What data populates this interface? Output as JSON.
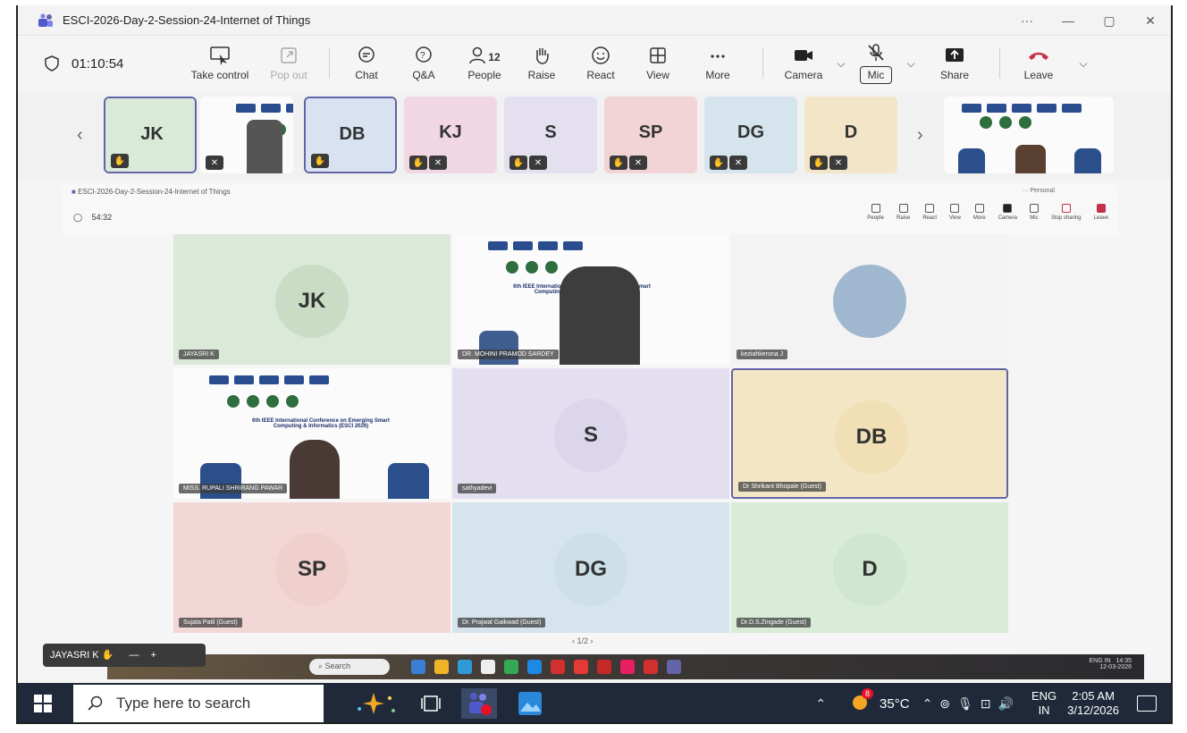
{
  "window": {
    "title": "ESCI-2026-Day-2-Session-24-Internet of Things",
    "more": "···",
    "minimize": "—",
    "maximize": "▢",
    "close": "✕"
  },
  "toolbar": {
    "timer": "01:10:54",
    "take_control": "Take control",
    "pop_out": "Pop out",
    "chat": "Chat",
    "qa": "Q&A",
    "people": "People",
    "people_count": "12",
    "raise": "Raise",
    "react": "React",
    "view": "View",
    "more": "More",
    "camera": "Camera",
    "mic": "Mic",
    "share": "Share",
    "leave": "Leave"
  },
  "strip": {
    "thumbs": [
      {
        "initials": "JK",
        "color": "#d9ead8"
      },
      {
        "initials": "DB",
        "color": "#d8e2f0"
      },
      {
        "initials": "KJ",
        "color": "#f1d6e4"
      },
      {
        "initials": "S",
        "color": "#e4e0f0"
      },
      {
        "initials": "SP",
        "color": "#f3d4d6"
      },
      {
        "initials": "DG",
        "color": "#d6e4ee"
      },
      {
        "initials": "D",
        "color": "#f3e6c8"
      }
    ]
  },
  "inner": {
    "title": "ESCI-2026-Day-2-Session-24-Internet of Things",
    "time": "54:32",
    "personal": "··· Personal",
    "people_count": "12",
    "tools": [
      "People",
      "Raise",
      "React",
      "View",
      "More",
      "Camera",
      "Mic",
      "Stop sharing",
      "Leave"
    ]
  },
  "grid": {
    "tiles": [
      {
        "initials": "JK",
        "color": "#dbe9d8",
        "label": "JAYASRI K"
      },
      {
        "initials": "",
        "color": "#fbfbfb",
        "label": "DR. MOHINI PRAMOD SARDEY"
      },
      {
        "initials": "",
        "color": "#f3f3f3",
        "label": "keziahkerona J"
      },
      {
        "initials": "",
        "color": "#fbfbfb",
        "label": "MISS. RUPALI SHRIRANG PAWAR"
      },
      {
        "initials": "S",
        "color": "#e3dff0",
        "label": "sathyadevi"
      },
      {
        "initials": "DB",
        "color": "#f3e6c4",
        "label": "Dr Shrikant Bhopale (Guest)"
      },
      {
        "initials": "SP",
        "color": "#f3d6d6",
        "label": "Sujata Patil (Guest)"
      },
      {
        "initials": "DG",
        "color": "#d6e4ee",
        "label": "Dr. Prajwal Gaikwad (Guest)"
      },
      {
        "initials": "D",
        "color": "#d8ecd8",
        "label": "Dr.D.S.Zingade (Guest)"
      }
    ],
    "slide_heading": "6th IEEE International Conference on Emerging Smart Computing & Informatics (ESCI 2026)"
  },
  "pager": "1/2",
  "presenter_chip": {
    "name": "JAYASRI K",
    "minus": "—",
    "plus": "+"
  },
  "inner_taskbar": {
    "search": "Search",
    "lang": "ENG IN",
    "time": "14:35",
    "date": "12-03-2026"
  },
  "taskbar": {
    "search_placeholder": "Type here to search",
    "weather": "35°C",
    "lang_top": "ENG",
    "lang_bottom": "IN",
    "time": "2:05 AM",
    "date": "3/12/2026",
    "badge": "8"
  }
}
